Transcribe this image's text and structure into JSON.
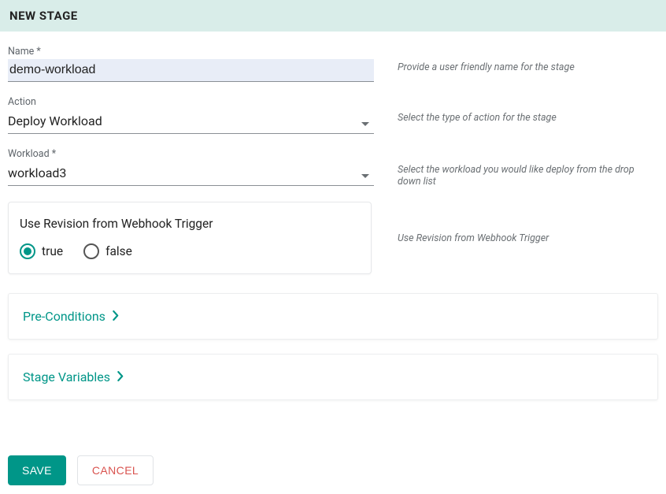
{
  "header": {
    "title": "NEW STAGE"
  },
  "fields": {
    "name": {
      "label": "Name *",
      "value": "demo-workload",
      "help": "Provide a user friendly name for the stage"
    },
    "action": {
      "label": "Action",
      "value": "Deploy Workload",
      "help": "Select the type of action for the stage"
    },
    "workload": {
      "label": "Workload *",
      "value": "workload3",
      "help": "Select the workload you would like deploy from the drop down list"
    },
    "revision": {
      "title": "Use Revision from Webhook Trigger",
      "help": "Use Revision from Webhook Trigger",
      "option_true": "true",
      "option_false": "false",
      "selected": "true"
    }
  },
  "sections": {
    "preconditions": "Pre-Conditions",
    "stagevars": "Stage Variables"
  },
  "buttons": {
    "save": "SAVE",
    "cancel": "CANCEL"
  }
}
